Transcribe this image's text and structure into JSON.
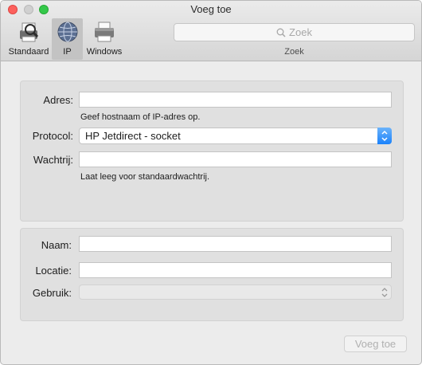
{
  "window": {
    "title": "Voeg toe"
  },
  "toolbar": {
    "items": [
      {
        "label": "Standaard",
        "icon": "default-printer-icon"
      },
      {
        "label": "IP",
        "icon": "globe-icon",
        "selected": true
      },
      {
        "label": "Windows",
        "icon": "windows-printer-icon"
      }
    ],
    "search": {
      "placeholder": "Zoek",
      "label": "Zoek"
    }
  },
  "connection": {
    "address": {
      "label": "Adres:",
      "value": "",
      "hint": "Geef hostnaam of IP-adres op."
    },
    "protocol": {
      "label": "Protocol:",
      "value": "HP Jetdirect - socket"
    },
    "queue": {
      "label": "Wachtrij:",
      "value": "",
      "hint": "Laat leeg voor standaardwachtrij."
    }
  },
  "printer": {
    "name": {
      "label": "Naam:",
      "value": ""
    },
    "location": {
      "label": "Locatie:",
      "value": ""
    },
    "use": {
      "label": "Gebruik:",
      "value": ""
    }
  },
  "actions": {
    "add_label": "Voeg toe"
  },
  "colors": {
    "accent": "#1a82fb",
    "close": "#fc605c",
    "zoom": "#34c84a"
  }
}
